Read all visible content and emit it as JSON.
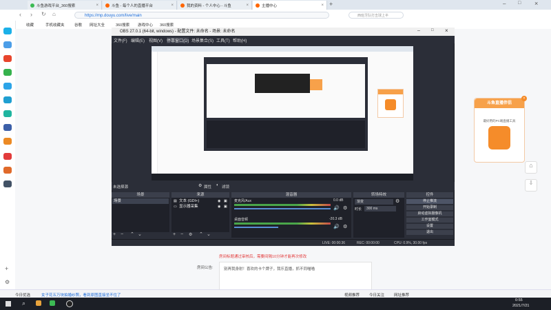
{
  "browser": {
    "tabs": [
      {
        "label": "斗鱼游戏平台_360搜索"
      },
      {
        "label": "斗鱼 - 每个人的直播平台"
      },
      {
        "label": "我的资料 - 个人中心 - 斗鱼"
      },
      {
        "label": "主播中心"
      }
    ],
    "url": "https://mp.douyu.com/live/main",
    "search_placeholder": "西班牙队打击球上半",
    "bookmarks": [
      "收藏",
      "手机收藏夹",
      "谷歌",
      "网址大全",
      "360搜索",
      "游戏中心",
      "360搜索"
    ]
  },
  "obs": {
    "title": "OBS 27.0.1 (64-bit, windows) - 配置文件: 未命名 - 场景: 未命名",
    "menu": [
      "文件(F)",
      "编辑(E)",
      "视图(V)",
      "停靠窗口(D)",
      "场景集合(S)",
      "工具(T)",
      "帮助(H)"
    ],
    "source_selected": "未选择源",
    "properties_label": "属性",
    "filters_label": "滤镜",
    "panels": {
      "scenes": "场景",
      "sources": "来源",
      "mixer": "混音器",
      "transitions": "转场特效",
      "controls": "控件"
    },
    "scenes": [
      "场景"
    ],
    "sources": [
      "文本 (GDI+)",
      "显示器采集"
    ],
    "mixer": [
      {
        "name": "麦克风/Aux",
        "db": "0.0 dB",
        "level": 0.85
      },
      {
        "name": "桌面音频",
        "db": "-20.3 dB",
        "level": 0.45
      }
    ],
    "transition": {
      "value": "渐变",
      "duration_label": "时长",
      "duration": "300 ms"
    },
    "controls": [
      "停止推流",
      "开始录制",
      "启动虚拟摄像机",
      "工作室模式",
      "设置",
      "退出"
    ],
    "status": {
      "live": "LIVE: 00:00:36",
      "rec": "REC: 00:00:00",
      "cpu": "CPU: 0.9%, 30.00 fps"
    }
  },
  "page": {
    "warning": "房间标题通过审核后，需要间隔10分钟才能再次修改",
    "announce_label": "房间公告:",
    "announce_text": "别再我身射！喜欢的卡个牌子，我乐直播，抓不同喵喵"
  },
  "ad": {
    "title": "斗鱼直播伴侣",
    "sub": "最好用的PC端直播工具"
  },
  "statusbar": {
    "left": "今日优选",
    "news": "女子花五万块拍婚纱照，看到原图直接坐不住了",
    "right": [
      "视频推荐",
      "今日关注",
      "网址推荐"
    ]
  },
  "taskbar": {
    "time": "0:55",
    "date": "2021/7/21"
  }
}
